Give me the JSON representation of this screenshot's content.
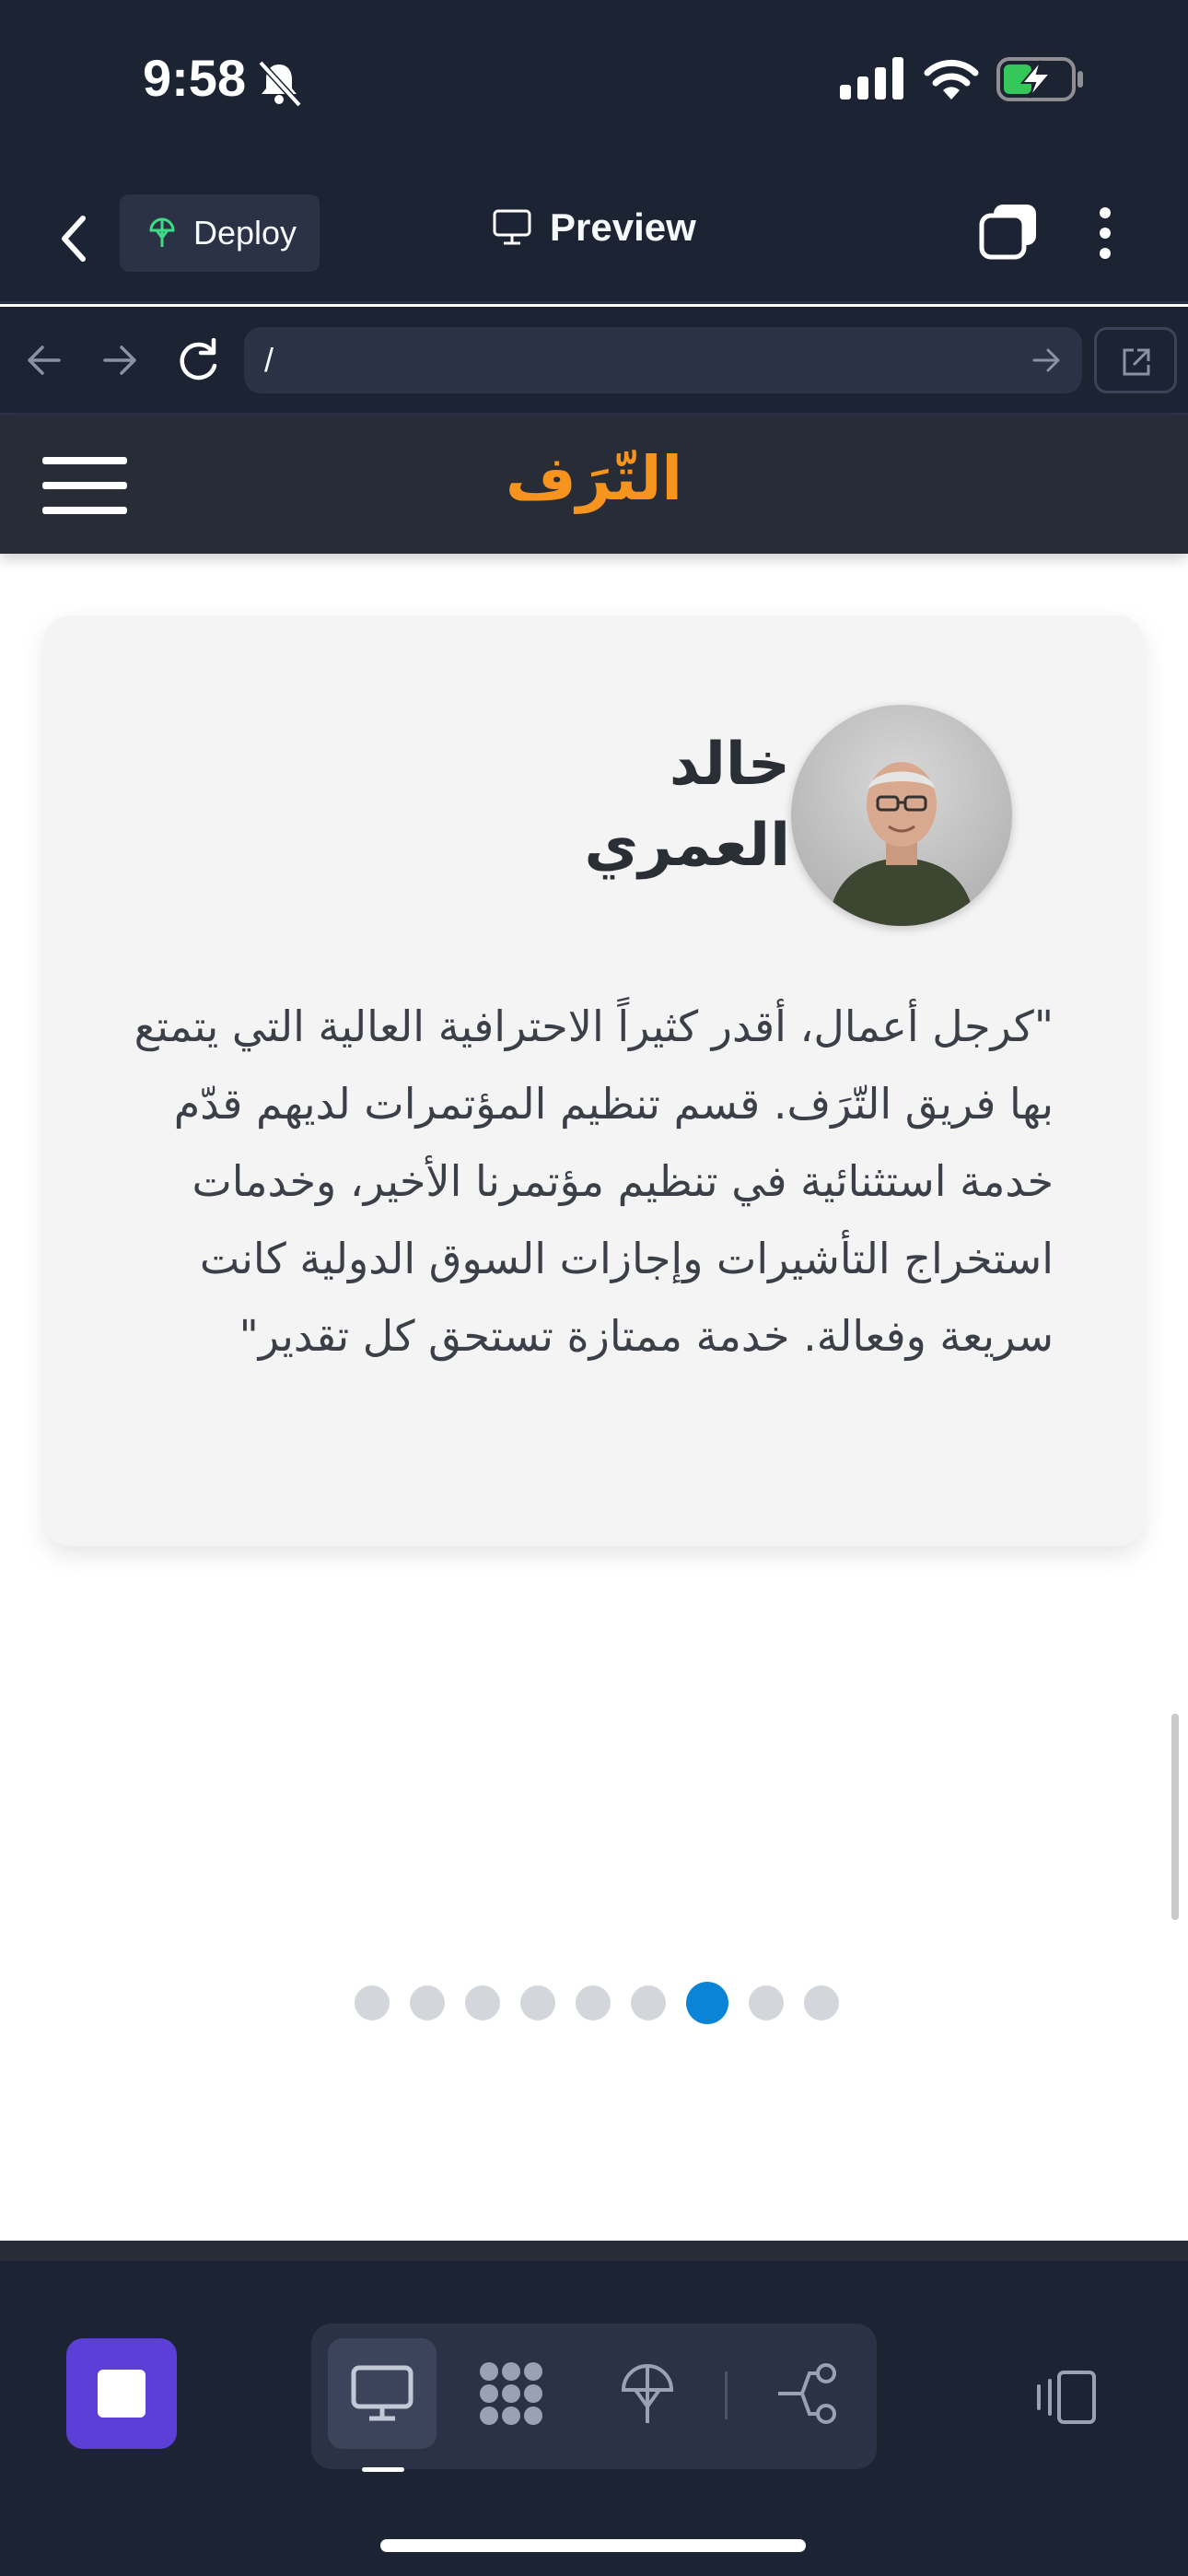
{
  "status_bar": {
    "time": "9:58"
  },
  "header": {
    "deploy_label": "Deploy",
    "preview_label": "Preview"
  },
  "url_bar": {
    "url": "/"
  },
  "site": {
    "logo": "التّرَف"
  },
  "testimonial": {
    "author": "خالد العمري",
    "quote": "\"كرجل أعمال، أقدر كثيراً الاحترافية العالية التي يتمتع بها فريق التّرَف. قسم تنظيم المؤتمرات لديهم قدّم خدمة استثنائية في تنظيم مؤتمرنا الأخير، وخدمات استخراج التأشيرات وإجازات السوق الدولية كانت سريعة وفعالة. خدمة ممتازة تستحق كل تقدير\""
  },
  "carousel": {
    "count": 9,
    "active_index": 6
  },
  "colors": {
    "ide_bg": "#1c2333",
    "logo": "#f7941d",
    "active_dot": "#0a84d6",
    "stop_button": "#5b3fd6"
  },
  "toolbar": {
    "tools": [
      "preview-icon",
      "modules-icon",
      "deploy-icon",
      "git-icon"
    ],
    "active_tool": "preview-icon"
  }
}
